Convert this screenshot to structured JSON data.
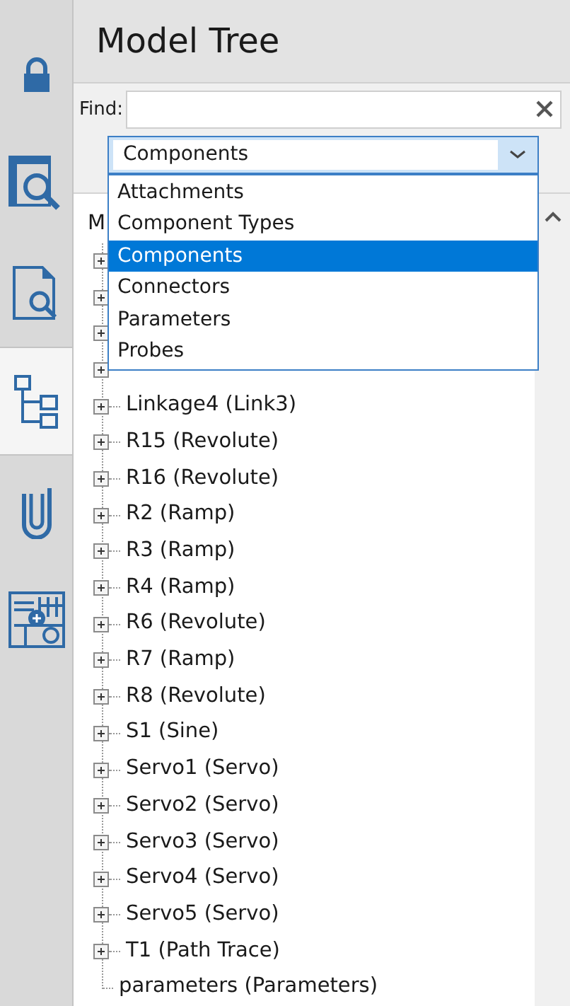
{
  "sidebar": {
    "tabs": [
      {
        "kind": "lock",
        "selected": false
      },
      {
        "kind": "search-panel",
        "selected": false
      },
      {
        "kind": "document-search",
        "selected": false
      },
      {
        "kind": "tree",
        "selected": true
      },
      {
        "kind": "clip",
        "selected": false
      },
      {
        "kind": "grid",
        "selected": false
      }
    ]
  },
  "panel": {
    "title": "Model Tree",
    "find": {
      "label": "Find:"
    },
    "filter": {
      "value": "Components",
      "expanded": true,
      "options": [
        {
          "label": "Attachments",
          "selected": false
        },
        {
          "label": "Component Types",
          "selected": false
        },
        {
          "label": "Components",
          "selected": true
        },
        {
          "label": "Connectors",
          "selected": false
        },
        {
          "label": "Parameters",
          "selected": false
        },
        {
          "label": "Probes",
          "selected": false
        }
      ]
    },
    "tree": {
      "root": {
        "label": "M",
        "children": [
          {
            "expandable": true
          },
          {
            "expandable": true
          },
          {
            "expandable": true
          },
          {
            "expandable": true
          },
          {
            "label": "Linkage4 (Link3)",
            "expandable": true
          },
          {
            "label": "R15 (Revolute)",
            "expandable": true
          },
          {
            "label": "R16 (Revolute)",
            "expandable": true
          },
          {
            "label": "R2 (Ramp)",
            "expandable": true
          },
          {
            "label": "R3 (Ramp)",
            "expandable": true
          },
          {
            "label": "R4 (Ramp)",
            "expandable": true
          },
          {
            "label": "R6 (Revolute)",
            "expandable": true
          },
          {
            "label": "R7 (Ramp)",
            "expandable": true
          },
          {
            "label": "R8 (Revolute)",
            "expandable": true
          },
          {
            "label": "S1 (Sine)",
            "expandable": true
          },
          {
            "label": "Servo1 (Servo)",
            "expandable": true
          },
          {
            "label": "Servo2 (Servo)",
            "expandable": true
          },
          {
            "label": "Servo3 (Servo)",
            "expandable": true
          },
          {
            "label": "Servo4 (Servo)",
            "expandable": true
          },
          {
            "label": "Servo5 (Servo)",
            "expandable": true
          },
          {
            "label": "T1 (Path Trace)",
            "expandable": true
          },
          {
            "label": "parameters (Parameters)",
            "expandable": false
          }
        ]
      }
    }
  }
}
